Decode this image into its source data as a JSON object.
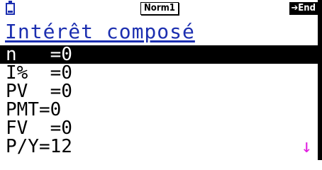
{
  "status": {
    "battery_icon": "battery-icon",
    "mode": "Norm1",
    "end_label": "➔End"
  },
  "title": "Intérêt composé",
  "variables": [
    {
      "text": "n   =0"
    },
    {
      "text": "I%  =0"
    },
    {
      "text": "PV  =0"
    },
    {
      "text": "PMT=0"
    },
    {
      "text": "FV  =0"
    },
    {
      "text": "P/Y=12"
    }
  ],
  "scroll_indicator": "↓",
  "colors": {
    "title": "#1c2fb0",
    "arrow": "#e11fe0",
    "highlight": "#000000"
  }
}
